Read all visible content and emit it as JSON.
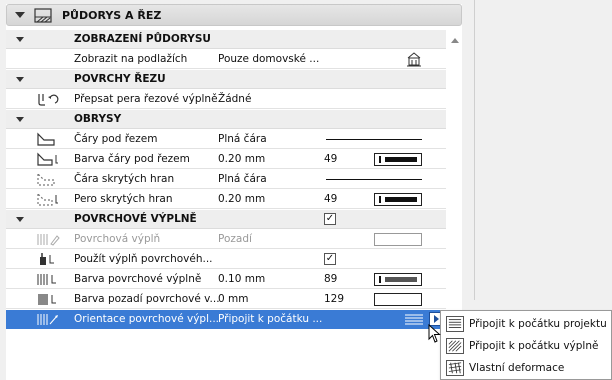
{
  "section": {
    "title": "PŮDORYS A ŘEZ",
    "icon": "floorplan-section-icon"
  },
  "groups": {
    "zobrazeni": "ZOBRAZENÍ PŮDORYSU",
    "povrchy": "POVRCHY ŘEZU",
    "obrysy": "OBRYSY",
    "vyplne": "POVRCHOVÉ VÝPLNĚ"
  },
  "rows": {
    "zobrazit": {
      "label": "Zobrazit na podlažích",
      "value": "Pouze domovské ..."
    },
    "prepsat": {
      "label": "Přepsat pera řezové výplně",
      "value": "Žádné"
    },
    "cary": {
      "label": "Čáry pod řezem",
      "value": "Plná čára"
    },
    "barva_cary": {
      "label": "Barva čáry pod řezem",
      "value": "0.20 mm",
      "num": "49"
    },
    "cara_skrytych": {
      "label": "Čára skrytých hran",
      "value": "Plná čára"
    },
    "pero_skrytych": {
      "label": "Pero skrytých hran",
      "value": "0.20 mm",
      "num": "49"
    },
    "povrchova_vypln": {
      "label": "Povrchová výplň",
      "value": "Pozadí"
    },
    "pouzit": {
      "label": "Použít výplň povrchovéh...",
      "checked": "✓"
    },
    "barva_vyplne": {
      "label": "Barva povrchové výplně",
      "value": "0.10 mm",
      "num": "89"
    },
    "barva_pozadi": {
      "label": "Barva pozadí povrchové v...",
      "value": "0 mm",
      "num": "129"
    },
    "orientace": {
      "label": "Orientace povrchové výpl...",
      "value": "Připojit k počátku ..."
    }
  },
  "group_vyplne_checked": "✓",
  "menu": {
    "items": [
      {
        "label": "Připojit k počátku projektu",
        "icon": "hatch-project-origin-icon"
      },
      {
        "label": "Připojit k počátku výplně",
        "icon": "hatch-fill-origin-icon"
      },
      {
        "label": "Vlastní deformace",
        "icon": "hatch-custom-distortion-icon"
      }
    ]
  },
  "colors": {
    "selection": "#3a7bd5",
    "group_bg": "#eeeeee",
    "header_bg": "#dadada"
  }
}
